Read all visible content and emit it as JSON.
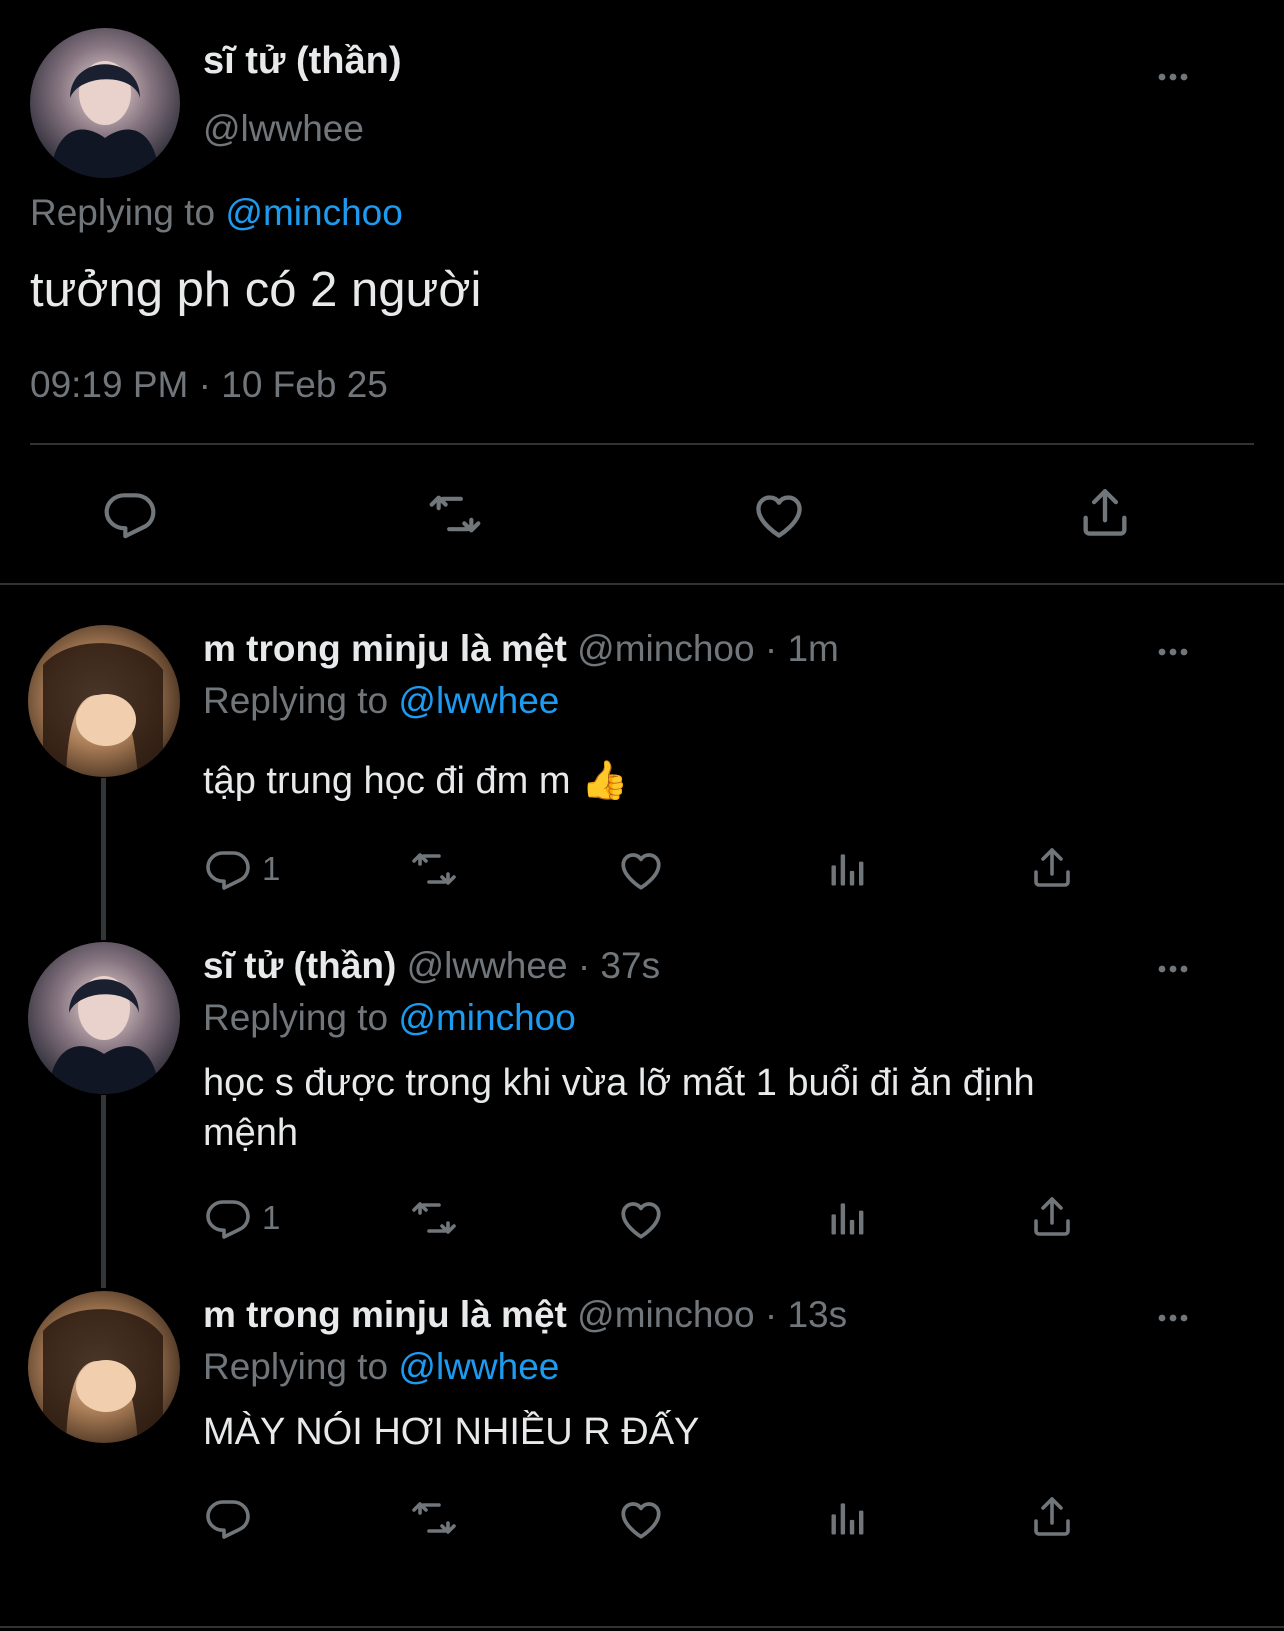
{
  "main_tweet": {
    "display_name": "sĩ tử (thần)",
    "handle": "@lwwhee",
    "replying_prefix": "Replying to",
    "replying_to": "@minchoo",
    "text": "tưởng ph có 2 người",
    "timestamp": "09:19 PM · 10 Feb 25",
    "actions": [
      "reply-icon",
      "retweet-icon",
      "like-icon",
      "share-icon"
    ]
  },
  "replies": [
    {
      "display_name": "m trong minju là mệt",
      "handle": "@minchoo",
      "time": "· 1m",
      "replying_prefix": "Replying to",
      "replying_to": "@lwwhee",
      "text": "tập trung học đi đm m",
      "emoji": "👍",
      "reply_count": "1"
    },
    {
      "display_name": "sĩ tử (thần)",
      "handle": "@lwwhee",
      "time": "· 37s",
      "replying_prefix": "Replying to",
      "replying_to": "@minchoo",
      "text_line1": "học s được trong khi vừa lỡ mất 1 buổi đi ăn định",
      "text_line2": "mệnh",
      "reply_count": "1"
    },
    {
      "display_name": "m trong minju là mệt",
      "handle": "@minchoo",
      "time": "· 13s",
      "replying_prefix": "Replying to",
      "replying_to": "@lwwhee",
      "text": "MÀY NÓI HƠI NHIỀU R ĐẤY",
      "reply_count": ""
    }
  ],
  "colors": {
    "background": "#000000",
    "text": "#e7e9ea",
    "secondary": "#71767b",
    "accent": "#1d9bf0",
    "divider": "#2f3336"
  }
}
